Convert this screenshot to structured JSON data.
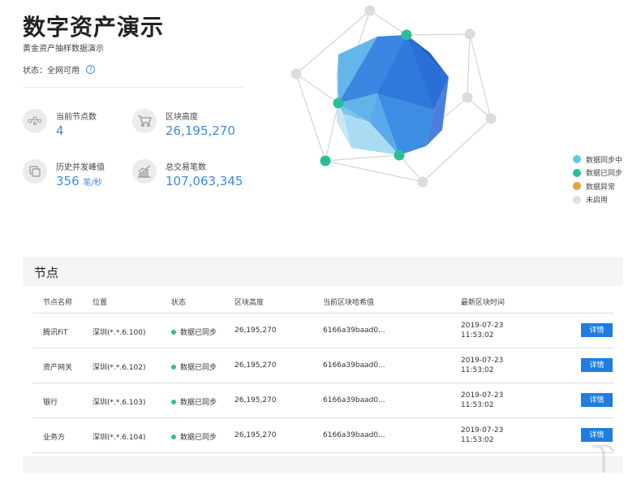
{
  "header": {
    "title": "数字资产演示",
    "subtitle": "黄金资产抽样数据演示",
    "status_label": "状态：",
    "status_value": "全网可用",
    "help_glyph": "?"
  },
  "stats": {
    "nodes": {
      "label": "当前节点数",
      "value": "4",
      "icon": "network-icon"
    },
    "block_height": {
      "label": "区块高度",
      "value": "26,195,270",
      "icon": "cart-icon"
    },
    "peak_concurrency": {
      "label": "历史并发峰值",
      "value": "356",
      "unit": "笔/秒",
      "icon": "stack-icon"
    },
    "total_tx": {
      "label": "总交易笔数",
      "value": "107,063,345",
      "icon": "trend-chart-icon"
    }
  },
  "legend": [
    {
      "label": "数据同步中",
      "color": "#5bc8f0"
    },
    {
      "label": "数据已同步",
      "color": "#2bbf99"
    },
    {
      "label": "数据异常",
      "color": "#e8a23a"
    },
    {
      "label": "未启用",
      "color": "#e0e0e0"
    }
  ],
  "nodes_section": {
    "title": "节点",
    "columns": [
      "节点名称",
      "位置",
      "状态",
      "区块高度",
      "当前区块哈希值",
      "最新区块时间"
    ],
    "detail_label": "详情",
    "rows": [
      {
        "name": "腾讯FiT",
        "location": "深圳(*.*.6.100)",
        "status": "数据已同步",
        "height": "26,195,270",
        "hash": "6166a39baad0...",
        "date": "2019-07-23",
        "time": "11:53:02"
      },
      {
        "name": "资产网关",
        "location": "深圳(*.*.6.102)",
        "status": "数据已同步",
        "height": "26,195,270",
        "hash": "6166a39baad0...",
        "date": "2019-07-23",
        "time": "11:53:02"
      },
      {
        "name": "银行",
        "location": "深圳(*.*.6.103)",
        "status": "数据已同步",
        "height": "26,195,270",
        "hash": "6166a39baad0...",
        "date": "2019-07-23",
        "time": "11:53:02"
      },
      {
        "name": "业务方",
        "location": "深圳(*.*.6.104)",
        "status": "数据已同步",
        "height": "26,195,270",
        "hash": "6166a39baad0...",
        "date": "2019-07-23",
        "time": "11:53:02"
      }
    ]
  },
  "colors": {
    "accent": "#1e7de0",
    "value_blue": "#3b8be0",
    "synced_green": "#2bbf99",
    "inactive_gray": "#e0e0e0"
  }
}
